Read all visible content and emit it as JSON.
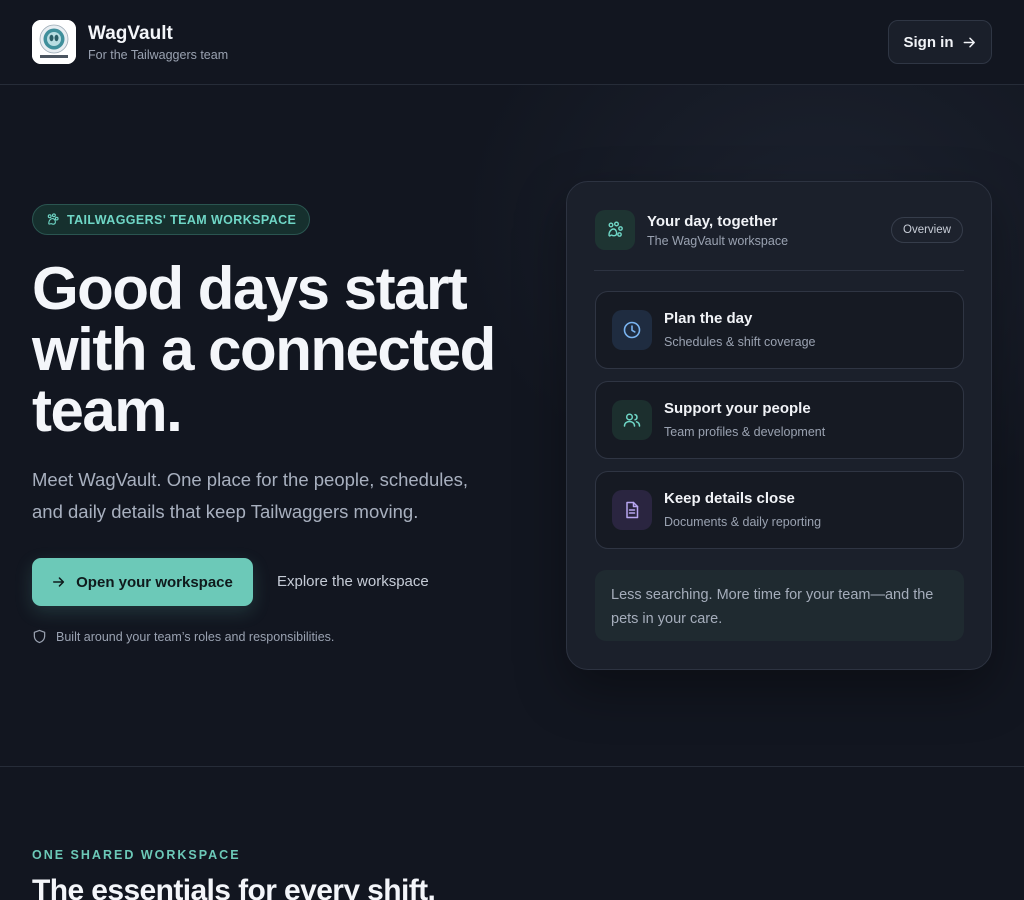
{
  "header": {
    "brand_name": "WagVault",
    "brand_tagline": "For the Tailwaggers team",
    "signin_label": "Sign in"
  },
  "hero": {
    "pill_label": "TAILWAGGERS' TEAM WORKSPACE",
    "title_lines": [
      "Good days start",
      "with a connected",
      "team."
    ],
    "description_lines": [
      "Meet WagVault. One place for the people, schedules,",
      "and daily details that keep Tailwaggers moving."
    ],
    "primary_cta": "Open your workspace",
    "secondary_cta": "Explore the workspace",
    "note": "Built around your team’s roles and responsibilities."
  },
  "card": {
    "title": "Your day, together",
    "subtitle": "The WagVault workspace",
    "badge": "Overview",
    "features": [
      {
        "title": "Plan the day",
        "subtitle": "Schedules & shift coverage",
        "icon": "clock-icon"
      },
      {
        "title": "Support your people",
        "subtitle": "Team profiles & development",
        "icon": "users-icon"
      },
      {
        "title": "Keep details close",
        "subtitle": "Documents & daily reporting",
        "icon": "document-icon"
      }
    ],
    "quote_lines": [
      "Less searching. More time for your team—and the",
      "pets in your care."
    ]
  },
  "section": {
    "eyebrow": "ONE SHARED WORKSPACE",
    "title": "The essentials for every shift."
  },
  "colors": {
    "background": "#121620",
    "accent": "#6cc9b8",
    "card": "#1b202b"
  }
}
